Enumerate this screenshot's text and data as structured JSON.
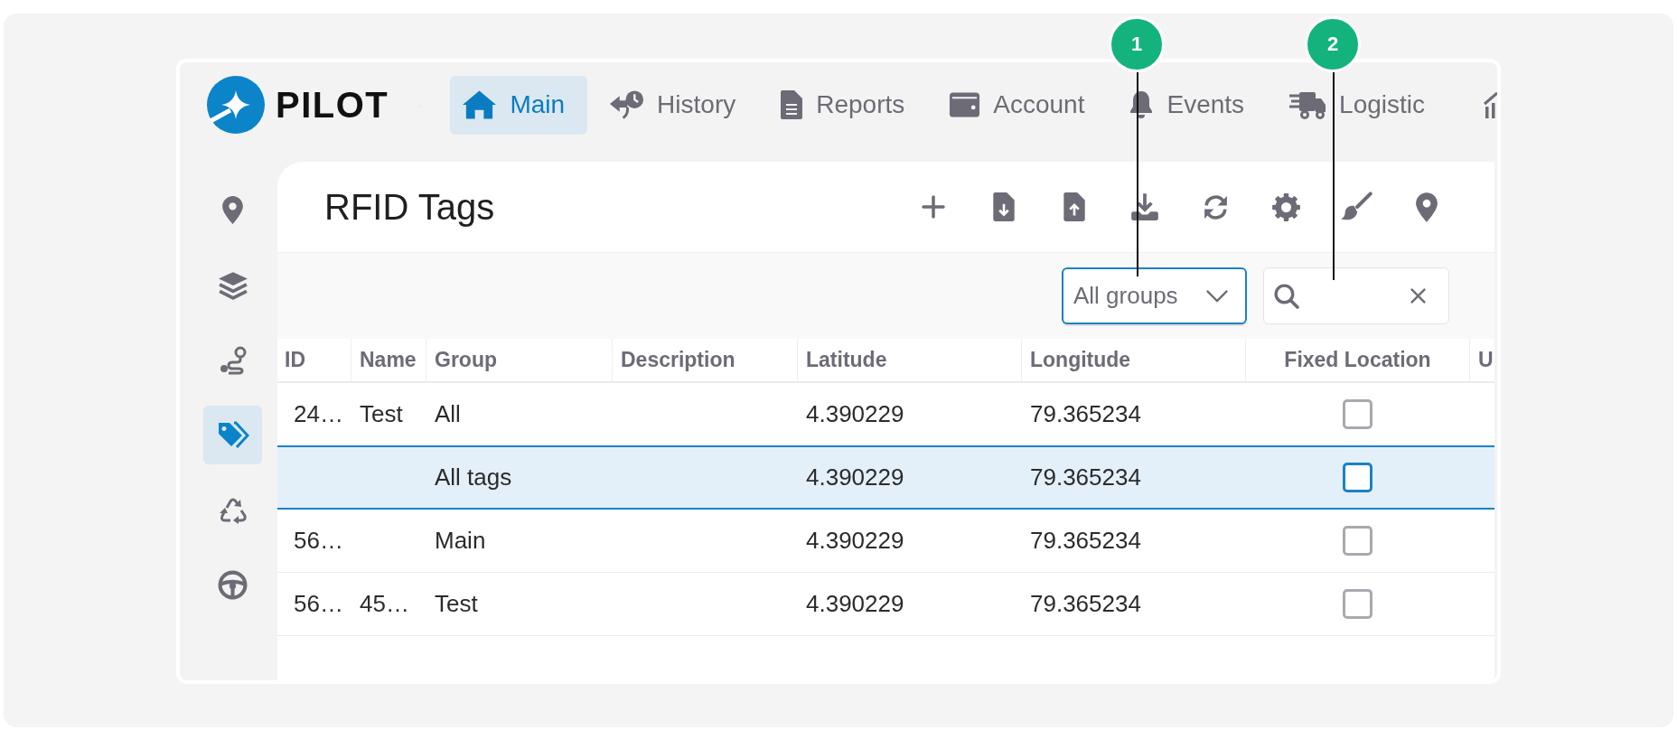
{
  "annotations": [
    {
      "label": "1"
    },
    {
      "label": "2"
    }
  ],
  "brand": {
    "name": "PILOT"
  },
  "nav": {
    "items": [
      {
        "label": "Main",
        "selected": true
      },
      {
        "label": "History",
        "selected": false
      },
      {
        "label": "Reports",
        "selected": false
      },
      {
        "label": "Account",
        "selected": false
      },
      {
        "label": "Events",
        "selected": false
      },
      {
        "label": "Logistic",
        "selected": false
      }
    ]
  },
  "sidebar": {
    "items": [
      {
        "selected": false
      },
      {
        "selected": false
      },
      {
        "selected": false
      },
      {
        "selected": true
      },
      {
        "selected": false
      },
      {
        "selected": false
      }
    ]
  },
  "page": {
    "title": "RFID Tags"
  },
  "filters": {
    "group_select": {
      "value": "All groups",
      "focused": true
    },
    "search": {
      "focused": false
    }
  },
  "table": {
    "columns": [
      {
        "label": "ID"
      },
      {
        "label": "Name"
      },
      {
        "label": "Group"
      },
      {
        "label": "Description"
      },
      {
        "label": "Latitude"
      },
      {
        "label": "Longitude"
      },
      {
        "label": "Fixed Location"
      },
      {
        "label": "U"
      }
    ],
    "rows": [
      {
        "id": "24…",
        "name": "Test",
        "group": "All",
        "latitude": "4.390229",
        "longitude": "79.365234",
        "fixed_location": false,
        "selected": false
      },
      {
        "group": "All tags",
        "latitude": "4.390229",
        "longitude": "79.365234",
        "fixed_location": false,
        "selected": true
      },
      {
        "id": "56…",
        "group": "Main",
        "latitude": "4.390229",
        "longitude": "79.365234",
        "fixed_location": false,
        "selected": false
      },
      {
        "id": "56…",
        "name": "45…",
        "group": "Test",
        "latitude": "4.390229",
        "longitude": "79.365234",
        "fixed_location": false,
        "selected": false
      }
    ]
  }
}
